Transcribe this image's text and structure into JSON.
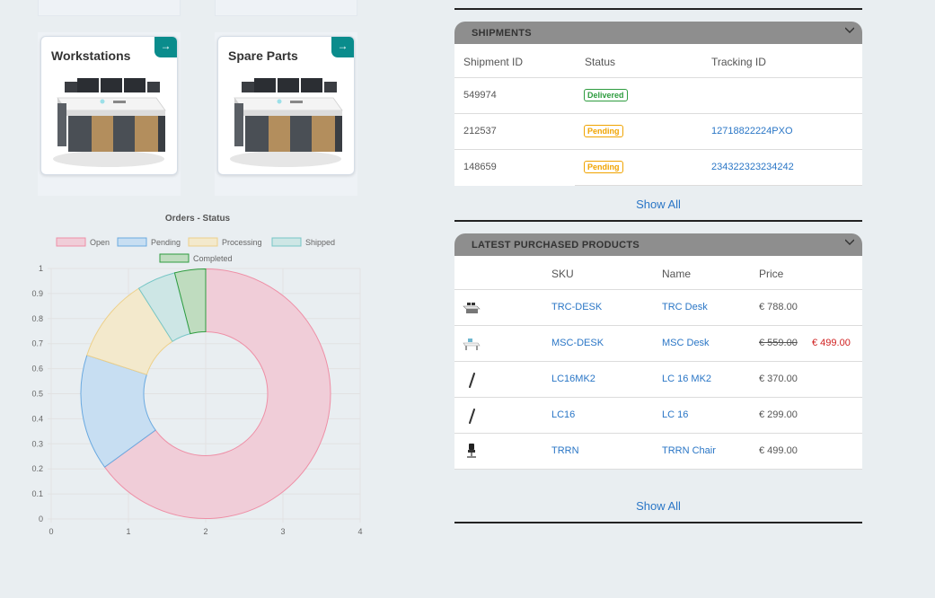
{
  "tiles": [
    {
      "title": "Workstations",
      "arrow": "→"
    },
    {
      "title": "Spare Parts",
      "arrow": "→"
    }
  ],
  "chart_data": {
    "type": "pie",
    "title": "Orders - Status",
    "legend": [
      "Open",
      "Pending",
      "Processing",
      "Shipped",
      "Completed"
    ],
    "labels": [
      "Open",
      "Pending",
      "Processing",
      "Shipped",
      "Completed"
    ],
    "values": [
      65,
      15,
      11,
      5,
      4
    ],
    "colors": {
      "Open": {
        "fill": "#f0cdd8",
        "stroke": "#ee8fa6"
      },
      "Pending": {
        "fill": "#c7def2",
        "stroke": "#6aa9e0"
      },
      "Processing": {
        "fill": "#f3e9cc",
        "stroke": "#edd08a"
      },
      "Shipped": {
        "fill": "#cde6e5",
        "stroke": "#76c6c6"
      },
      "Completed": {
        "fill": "#bfdcbf",
        "stroke": "#2e9c3f"
      }
    },
    "x_ticks": [
      "0",
      "1",
      "2",
      "3",
      "4"
    ],
    "y_ticks": [
      "0",
      "0.1",
      "0.2",
      "0.3",
      "0.4",
      "0.5",
      "0.6",
      "0.7",
      "0.8",
      "0.9",
      "1"
    ],
    "xlim": [
      0,
      4
    ],
    "ylim": [
      0,
      1
    ],
    "grid": true,
    "legend_position": "top"
  },
  "shipments": {
    "title": "SHIPMENTS",
    "headers": {
      "id": "Shipment ID",
      "status": "Status",
      "tracking": "Tracking ID"
    },
    "rows": [
      {
        "id": "549974",
        "status": "Delivered",
        "tracking": ""
      },
      {
        "id": "212537",
        "status": "Pending",
        "tracking": "12718822224PXO"
      },
      {
        "id": "148659",
        "status": "Pending",
        "tracking": "234322323234242"
      }
    ],
    "show_all": "Show All"
  },
  "products": {
    "title": "LATEST PURCHASED PRODUCTS",
    "headers": {
      "sku": "SKU",
      "name": "Name",
      "price": "Price"
    },
    "rows": [
      {
        "sku": "TRC-DESK",
        "name": "TRC Desk",
        "price": "€ 788.00",
        "old_price": ""
      },
      {
        "sku": "MSC-DESK",
        "name": "MSC Desk",
        "price": "€ 499.00",
        "old_price": "€ 559.00"
      },
      {
        "sku": "LC16MK2",
        "name": "LC 16 MK2",
        "price": "€ 370.00",
        "old_price": ""
      },
      {
        "sku": "LC16",
        "name": "LC 16",
        "price": "€ 299.00",
        "old_price": ""
      },
      {
        "sku": "TRRN",
        "name": "TRRN Chair",
        "price": "€ 499.00",
        "old_price": ""
      }
    ],
    "show_all": "Show All"
  }
}
